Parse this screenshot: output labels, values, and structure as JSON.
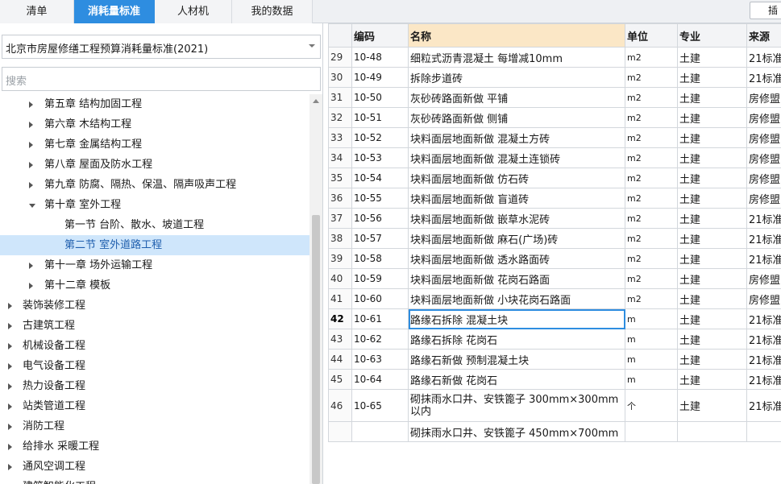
{
  "tabs": [
    {
      "label": "清单",
      "active": false
    },
    {
      "label": "消耗量标准",
      "active": true
    },
    {
      "label": "人材机",
      "active": false
    },
    {
      "label": "我的数据",
      "active": false
    }
  ],
  "insert_button": "插",
  "left_panel": {
    "standard_select": "北京市房屋修缮工程预算消耗量标准(2021)",
    "search_placeholder": "搜索",
    "tree": [
      {
        "label": "第五章 结构加固工程",
        "level": 1,
        "state": "collapsed"
      },
      {
        "label": "第六章 木结构工程",
        "level": 1,
        "state": "collapsed"
      },
      {
        "label": "第七章 金属结构工程",
        "level": 1,
        "state": "collapsed"
      },
      {
        "label": "第八章 屋面及防水工程",
        "level": 1,
        "state": "collapsed"
      },
      {
        "label": "第九章 防腐、隔热、保温、隔声吸声工程",
        "level": 1,
        "state": "collapsed"
      },
      {
        "label": "第十章 室外工程",
        "level": 1,
        "state": "expanded"
      },
      {
        "label": "第一节 台阶、散水、坡道工程",
        "level": 2,
        "state": "leaf"
      },
      {
        "label": "第二节 室外道路工程",
        "level": 2,
        "state": "leaf",
        "selected": true
      },
      {
        "label": "第十一章 场外运输工程",
        "level": 1,
        "state": "collapsed"
      },
      {
        "label": "第十二章 模板",
        "level": 1,
        "state": "collapsed"
      },
      {
        "label": "装饰装修工程",
        "level": 0,
        "state": "collapsed"
      },
      {
        "label": "古建筑工程",
        "level": 0,
        "state": "collapsed"
      },
      {
        "label": "机械设备工程",
        "level": 0,
        "state": "collapsed"
      },
      {
        "label": "电气设备工程",
        "level": 0,
        "state": "collapsed"
      },
      {
        "label": "热力设备工程",
        "level": 0,
        "state": "collapsed"
      },
      {
        "label": "站类管道工程",
        "level": 0,
        "state": "collapsed"
      },
      {
        "label": "消防工程",
        "level": 0,
        "state": "collapsed"
      },
      {
        "label": "给排水 采暖工程",
        "level": 0,
        "state": "collapsed"
      },
      {
        "label": "通风空调工程",
        "level": 0,
        "state": "collapsed"
      },
      {
        "label": "建筑智能化工程",
        "level": 0,
        "state": "collapsed"
      }
    ]
  },
  "grid": {
    "columns": [
      "",
      "编码",
      "名称",
      "单位",
      "专业",
      "来源"
    ],
    "rows": [
      {
        "n": "29",
        "code": "10-48",
        "name": "细粒式沥青混凝土 每增减10mm",
        "unit": "m2",
        "spec": "土建",
        "src": "21标准"
      },
      {
        "n": "30",
        "code": "10-49",
        "name": "拆除步道砖",
        "unit": "m2",
        "spec": "土建",
        "src": "21标准"
      },
      {
        "n": "31",
        "code": "10-50",
        "name": "灰砂砖路面新做 平铺",
        "unit": "m2",
        "spec": "土建",
        "src": "房修盟"
      },
      {
        "n": "32",
        "code": "10-51",
        "name": "灰砂砖路面新做 侧铺",
        "unit": "m2",
        "spec": "土建",
        "src": "房修盟"
      },
      {
        "n": "33",
        "code": "10-52",
        "name": "块料面层地面新做 混凝土方砖",
        "unit": "m2",
        "spec": "土建",
        "src": "房修盟"
      },
      {
        "n": "34",
        "code": "10-53",
        "name": "块料面层地面新做 混凝土连锁砖",
        "unit": "m2",
        "spec": "土建",
        "src": "房修盟"
      },
      {
        "n": "35",
        "code": "10-54",
        "name": "块料面层地面新做 仿石砖",
        "unit": "m2",
        "spec": "土建",
        "src": "房修盟"
      },
      {
        "n": "36",
        "code": "10-55",
        "name": "块料面层地面新做 盲道砖",
        "unit": "m2",
        "spec": "土建",
        "src": "房修盟"
      },
      {
        "n": "37",
        "code": "10-56",
        "name": "块料面层地面新做 嵌草水泥砖",
        "unit": "m2",
        "spec": "土建",
        "src": "21标准"
      },
      {
        "n": "38",
        "code": "10-57",
        "name": "块料面层地面新做 麻石(广场)砖",
        "unit": "m2",
        "spec": "土建",
        "src": "21标准"
      },
      {
        "n": "39",
        "code": "10-58",
        "name": "块料面层地面新做 透水路面砖",
        "unit": "m2",
        "spec": "土建",
        "src": "21标准"
      },
      {
        "n": "40",
        "code": "10-59",
        "name": "块料面层地面新做 花岗石路面",
        "unit": "m2",
        "spec": "土建",
        "src": "房修盟"
      },
      {
        "n": "41",
        "code": "10-60",
        "name": "块料面层地面新做 小块花岗石路面",
        "unit": "m2",
        "spec": "土建",
        "src": "房修盟"
      },
      {
        "n": "42",
        "code": "10-61",
        "name": "路缘石拆除 混凝土块",
        "unit": "m",
        "spec": "土建",
        "src": "21标准",
        "current": true
      },
      {
        "n": "43",
        "code": "10-62",
        "name": "路缘石拆除 花岗石",
        "unit": "m",
        "spec": "土建",
        "src": "21标准"
      },
      {
        "n": "44",
        "code": "10-63",
        "name": "路缘石新做 预制混凝土块",
        "unit": "m",
        "spec": "土建",
        "src": "21标准"
      },
      {
        "n": "45",
        "code": "10-64",
        "name": "路缘石新做 花岗石",
        "unit": "m",
        "spec": "土建",
        "src": "21标准"
      },
      {
        "n": "46",
        "code": "10-65",
        "name": "砌抹雨水口井、安铁篦子 300mm×300mm以内",
        "unit": "个",
        "spec": "土建",
        "src": "21标准",
        "tall": true
      },
      {
        "n": "",
        "code": "",
        "name": "砌抹雨水口井、安铁篦子 450mm×700mm",
        "unit": "",
        "spec": "",
        "src": ""
      }
    ]
  }
}
